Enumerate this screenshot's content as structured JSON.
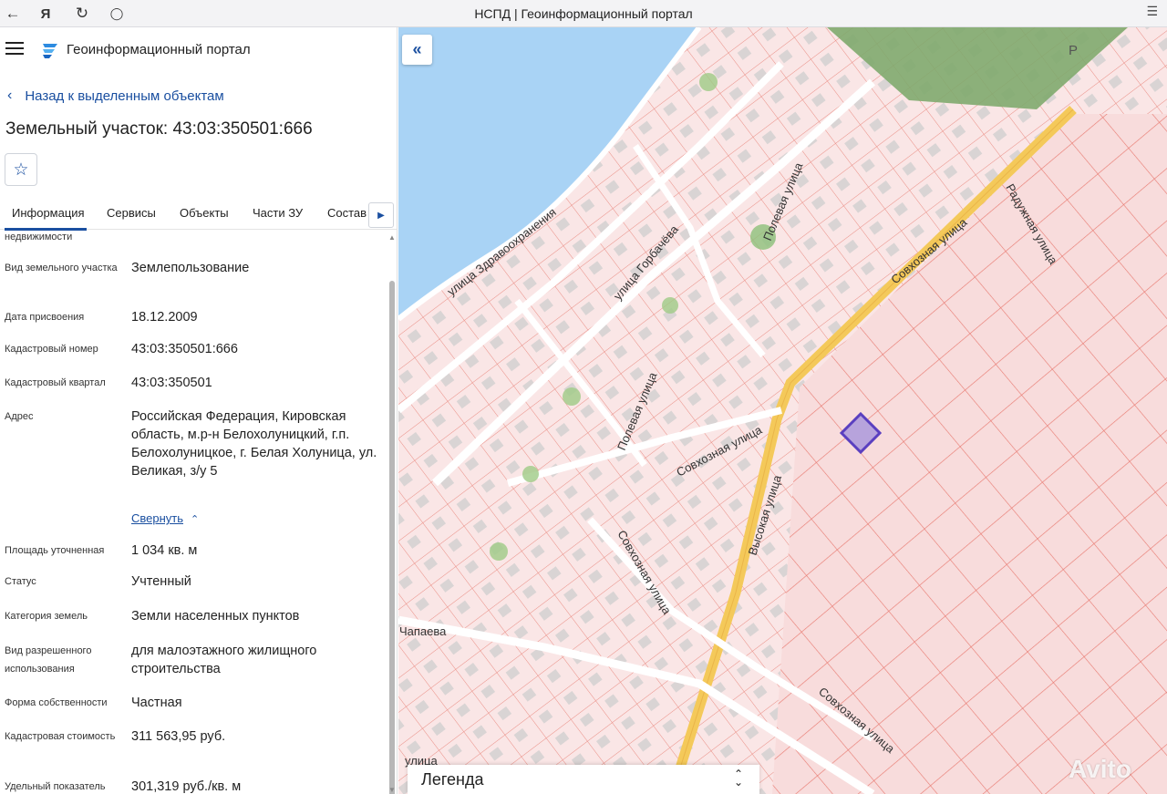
{
  "browser": {
    "window_title": "НСПД | Геоинформационный портал",
    "back_icon": "arrow-left-icon",
    "yandex_icon": "yandex-logo-icon",
    "reload_icon": "reload-icon",
    "shield_icon": "shield-icon"
  },
  "header": {
    "app_title": "Геоинформационный портал"
  },
  "nav": {
    "back_label": "Назад к выделенным объектам"
  },
  "object": {
    "title": "Земельный участок: 43:03:350501:666"
  },
  "tabs": [
    {
      "label": "Информация",
      "active": true
    },
    {
      "label": "Сервисы"
    },
    {
      "label": "Объекты"
    },
    {
      "label": "Части ЗУ"
    },
    {
      "label": "Состав"
    }
  ],
  "info": {
    "partial_label": "недвижимости",
    "rows": [
      {
        "label": "Вид земельного участка",
        "value": "Землепользование"
      },
      {
        "label": "Дата присвоения",
        "value": "18.12.2009"
      },
      {
        "label": "Кадастровый номер",
        "value": "43:03:350501:666"
      },
      {
        "label": "Кадастровый квартал",
        "value": "43:03:350501"
      },
      {
        "label": "Адрес",
        "value": "Российская Федерация, Кировская область, м.р-н Белохолуницкий, г.п. Белохолуницкое, г. Белая Холуница, ул. Великая, з/у 5"
      },
      {
        "label": "Площадь уточненная",
        "value": "1 034 кв. м"
      },
      {
        "label": "Статус",
        "value": "Учтенный"
      },
      {
        "label": "Категория земель",
        "value": "Земли населенных пунктов"
      },
      {
        "label": "Вид разрешенного использования",
        "value": "для малоэтажного жилищного строительства"
      },
      {
        "label": "Форма собственности",
        "value": "Частная"
      },
      {
        "label": "Кадастровая стоимость",
        "value": "311 563,95 руб."
      },
      {
        "label": "Удельный показатель кадастровой",
        "value": "301,319 руб./кв. м"
      }
    ],
    "collapse_label": "Свернуть"
  },
  "map": {
    "streets": {
      "s1": "улица Здравоохранения",
      "s2": "улица Горбачёва",
      "s3": "Полевая улица",
      "s4": "Полевая улица",
      "s5": "Совхозная улица",
      "s6": "Радужная улица",
      "s7": "Совхозная улица",
      "s8": "Высокая улица",
      "s9": "Совхозная улица",
      "s10": "Совхозная улица",
      "s11": "Чапаева",
      "s12": "улица"
    },
    "parking_label": "P",
    "legend_label": "Легенда",
    "colors": {
      "water": "#a9d3f5",
      "parcel_fill": "#f7dede",
      "parcel_stroke": "#e8786f",
      "road": "#ffffff",
      "main_road": "#f4c95a",
      "forest": "#7faa6e",
      "selected_fill": "#b7a3dc",
      "selected_stroke": "#5a3fc0"
    }
  },
  "watermark": "Avito"
}
